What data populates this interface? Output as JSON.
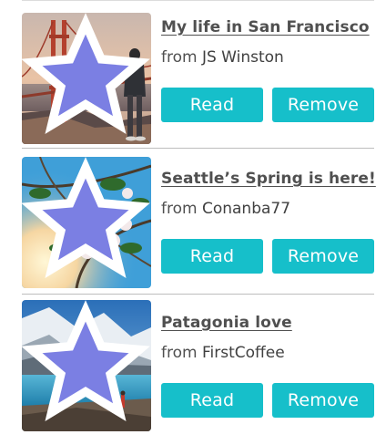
{
  "articles": [
    {
      "title": "My life in San Francisco",
      "from_label": "from",
      "author": "JS Winston",
      "read_label": "Read",
      "remove_label": "Remove",
      "starred": true
    },
    {
      "title": "Seattle’s Spring is here!",
      "from_label": "from",
      "author": "Conanba77",
      "read_label": "Read",
      "remove_label": "Remove",
      "starred": true
    },
    {
      "title": "Patagonia love",
      "from_label": "from",
      "author": "FirstCoffee",
      "read_label": "Read",
      "remove_label": "Remove",
      "starred": true
    }
  ],
  "colors": {
    "accent": "#16bfca",
    "star": "#7b7fe3",
    "text": "#505050",
    "divider": "#bdbdbd"
  },
  "icons": {
    "favorite": "star-icon"
  }
}
